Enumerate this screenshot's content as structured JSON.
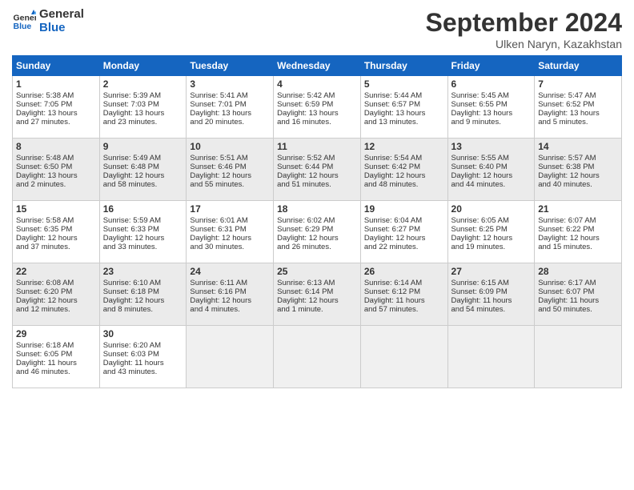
{
  "header": {
    "logo_line1": "General",
    "logo_line2": "Blue",
    "month_title": "September 2024",
    "subtitle": "Ulken Naryn, Kazakhstan"
  },
  "weekdays": [
    "Sunday",
    "Monday",
    "Tuesday",
    "Wednesday",
    "Thursday",
    "Friday",
    "Saturday"
  ],
  "rows": [
    [
      {
        "day": "1",
        "lines": [
          "Sunrise: 5:38 AM",
          "Sunset: 7:05 PM",
          "Daylight: 13 hours",
          "and 27 minutes."
        ]
      },
      {
        "day": "2",
        "lines": [
          "Sunrise: 5:39 AM",
          "Sunset: 7:03 PM",
          "Daylight: 13 hours",
          "and 23 minutes."
        ]
      },
      {
        "day": "3",
        "lines": [
          "Sunrise: 5:41 AM",
          "Sunset: 7:01 PM",
          "Daylight: 13 hours",
          "and 20 minutes."
        ]
      },
      {
        "day": "4",
        "lines": [
          "Sunrise: 5:42 AM",
          "Sunset: 6:59 PM",
          "Daylight: 13 hours",
          "and 16 minutes."
        ]
      },
      {
        "day": "5",
        "lines": [
          "Sunrise: 5:44 AM",
          "Sunset: 6:57 PM",
          "Daylight: 13 hours",
          "and 13 minutes."
        ]
      },
      {
        "day": "6",
        "lines": [
          "Sunrise: 5:45 AM",
          "Sunset: 6:55 PM",
          "Daylight: 13 hours",
          "and 9 minutes."
        ]
      },
      {
        "day": "7",
        "lines": [
          "Sunrise: 5:47 AM",
          "Sunset: 6:52 PM",
          "Daylight: 13 hours",
          "and 5 minutes."
        ]
      }
    ],
    [
      {
        "day": "8",
        "lines": [
          "Sunrise: 5:48 AM",
          "Sunset: 6:50 PM",
          "Daylight: 13 hours",
          "and 2 minutes."
        ]
      },
      {
        "day": "9",
        "lines": [
          "Sunrise: 5:49 AM",
          "Sunset: 6:48 PM",
          "Daylight: 12 hours",
          "and 58 minutes."
        ]
      },
      {
        "day": "10",
        "lines": [
          "Sunrise: 5:51 AM",
          "Sunset: 6:46 PM",
          "Daylight: 12 hours",
          "and 55 minutes."
        ]
      },
      {
        "day": "11",
        "lines": [
          "Sunrise: 5:52 AM",
          "Sunset: 6:44 PM",
          "Daylight: 12 hours",
          "and 51 minutes."
        ]
      },
      {
        "day": "12",
        "lines": [
          "Sunrise: 5:54 AM",
          "Sunset: 6:42 PM",
          "Daylight: 12 hours",
          "and 48 minutes."
        ]
      },
      {
        "day": "13",
        "lines": [
          "Sunrise: 5:55 AM",
          "Sunset: 6:40 PM",
          "Daylight: 12 hours",
          "and 44 minutes."
        ]
      },
      {
        "day": "14",
        "lines": [
          "Sunrise: 5:57 AM",
          "Sunset: 6:38 PM",
          "Daylight: 12 hours",
          "and 40 minutes."
        ]
      }
    ],
    [
      {
        "day": "15",
        "lines": [
          "Sunrise: 5:58 AM",
          "Sunset: 6:35 PM",
          "Daylight: 12 hours",
          "and 37 minutes."
        ]
      },
      {
        "day": "16",
        "lines": [
          "Sunrise: 5:59 AM",
          "Sunset: 6:33 PM",
          "Daylight: 12 hours",
          "and 33 minutes."
        ]
      },
      {
        "day": "17",
        "lines": [
          "Sunrise: 6:01 AM",
          "Sunset: 6:31 PM",
          "Daylight: 12 hours",
          "and 30 minutes."
        ]
      },
      {
        "day": "18",
        "lines": [
          "Sunrise: 6:02 AM",
          "Sunset: 6:29 PM",
          "Daylight: 12 hours",
          "and 26 minutes."
        ]
      },
      {
        "day": "19",
        "lines": [
          "Sunrise: 6:04 AM",
          "Sunset: 6:27 PM",
          "Daylight: 12 hours",
          "and 22 minutes."
        ]
      },
      {
        "day": "20",
        "lines": [
          "Sunrise: 6:05 AM",
          "Sunset: 6:25 PM",
          "Daylight: 12 hours",
          "and 19 minutes."
        ]
      },
      {
        "day": "21",
        "lines": [
          "Sunrise: 6:07 AM",
          "Sunset: 6:22 PM",
          "Daylight: 12 hours",
          "and 15 minutes."
        ]
      }
    ],
    [
      {
        "day": "22",
        "lines": [
          "Sunrise: 6:08 AM",
          "Sunset: 6:20 PM",
          "Daylight: 12 hours",
          "and 12 minutes."
        ]
      },
      {
        "day": "23",
        "lines": [
          "Sunrise: 6:10 AM",
          "Sunset: 6:18 PM",
          "Daylight: 12 hours",
          "and 8 minutes."
        ]
      },
      {
        "day": "24",
        "lines": [
          "Sunrise: 6:11 AM",
          "Sunset: 6:16 PM",
          "Daylight: 12 hours",
          "and 4 minutes."
        ]
      },
      {
        "day": "25",
        "lines": [
          "Sunrise: 6:13 AM",
          "Sunset: 6:14 PM",
          "Daylight: 12 hours",
          "and 1 minute."
        ]
      },
      {
        "day": "26",
        "lines": [
          "Sunrise: 6:14 AM",
          "Sunset: 6:12 PM",
          "Daylight: 11 hours",
          "and 57 minutes."
        ]
      },
      {
        "day": "27",
        "lines": [
          "Sunrise: 6:15 AM",
          "Sunset: 6:09 PM",
          "Daylight: 11 hours",
          "and 54 minutes."
        ]
      },
      {
        "day": "28",
        "lines": [
          "Sunrise: 6:17 AM",
          "Sunset: 6:07 PM",
          "Daylight: 11 hours",
          "and 50 minutes."
        ]
      }
    ],
    [
      {
        "day": "29",
        "lines": [
          "Sunrise: 6:18 AM",
          "Sunset: 6:05 PM",
          "Daylight: 11 hours",
          "and 46 minutes."
        ]
      },
      {
        "day": "30",
        "lines": [
          "Sunrise: 6:20 AM",
          "Sunset: 6:03 PM",
          "Daylight: 11 hours",
          "and 43 minutes."
        ]
      },
      {
        "day": "",
        "lines": [],
        "empty": true
      },
      {
        "day": "",
        "lines": [],
        "empty": true
      },
      {
        "day": "",
        "lines": [],
        "empty": true
      },
      {
        "day": "",
        "lines": [],
        "empty": true
      },
      {
        "day": "",
        "lines": [],
        "empty": true
      }
    ]
  ]
}
